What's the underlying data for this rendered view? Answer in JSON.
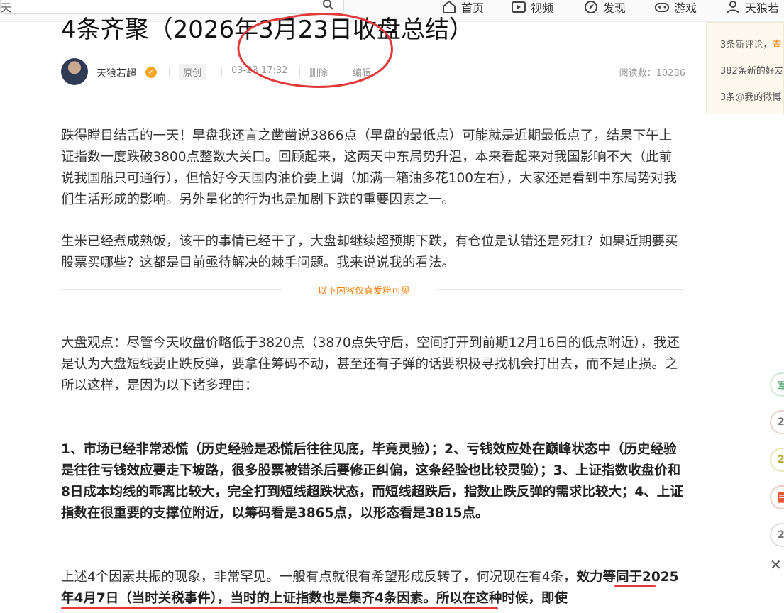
{
  "header": {
    "search_placeholder": "天",
    "nav": [
      {
        "label": "首页",
        "icon": "home-icon"
      },
      {
        "label": "视频",
        "icon": "video-icon"
      },
      {
        "label": "发现",
        "icon": "discover-icon"
      },
      {
        "label": "游戏",
        "icon": "game-icon"
      },
      {
        "label": "天狼若",
        "icon": "user-icon"
      }
    ]
  },
  "notifications": [
    {
      "text": "3条新评论，",
      "link": "查"
    },
    {
      "text": "382条新的好友",
      "link": ""
    },
    {
      "text": "3条@我的微博",
      "link": ""
    }
  ],
  "side_badges": [
    "军",
    "2",
    "2",
    "",
    "2"
  ],
  "article": {
    "title": "4条齐聚（2026年3月23日收盘总结）",
    "author": "天狼若超",
    "tag": "原创",
    "time": "03-23 17:32",
    "delete_label": "删除",
    "edit_label": "编辑",
    "reads": "阅读数：10236",
    "p1": "跌得瞠目结舌的一天！早盘我还言之凿凿说3866点（早盘的最低点）可能就是近期最低点了，结果下午上证指数一度跌破3800点整数大关口。回顾起来，这两天中东局势升温，本来看起来对我国影响不大（此前说我国船只可通行），但恰好今天国内油价要上调（加满一箱油多花100左右），大家还是看到中东局势对我们生活形成的影响。另外量化的行为也是加剧下跌的重要因素之一。",
    "p2": "生米已经煮成熟饭，该干的事情已经干了，大盘却继续超预期下跌，有仓位是认错还是死扛？如果近期要买股票买哪些？这都是目前亟待解决的棘手问题。我来说说我的看法。",
    "fans_only": "以下内容仅真爱粉可见",
    "p3": "大盘观点：尽管今天收盘价略低于3820点（3870点失守后，空间打开到前期12月16日的低点附近），我还是认为大盘短线要止跌反弹，要拿住筹码不动，甚至还有子弹的话要积极寻找机会打出去，而不是止损。之所以这样，是因为以下诸多理由：",
    "p4": "1、市场已经非常恐慌（历史经验是恐慌后往往见底，毕竟灵验）；2、亏钱效应处在巅峰状态中（历史经验是往往亏钱效应要走下坡路，很多股票被错杀后要修正纠偏，这条经验也比较灵验）；3、上证指数收盘价和8日成本均线的乖离比较大，完全打到短线超跌状态，而短线超跌后，指数止跌反弹的需求比较大；4、上证指数在很重要的支撑位附近，以筹码看是3865点，以形态看是3815点。",
    "p5_normal": "上述4个因素共振的现象，非常罕见。一般有点就很有希望形成反转了，何况现在有4条，",
    "p5_bold": "效力等同于2025年4月7日（当时关税事件），当时的上证指数也是集齐4条因素。所以在这种时候，即使"
  },
  "colors": {
    "accent": "#f57c00",
    "annotation": "#e23a3a",
    "notif_bg": "#fdf9ef"
  }
}
